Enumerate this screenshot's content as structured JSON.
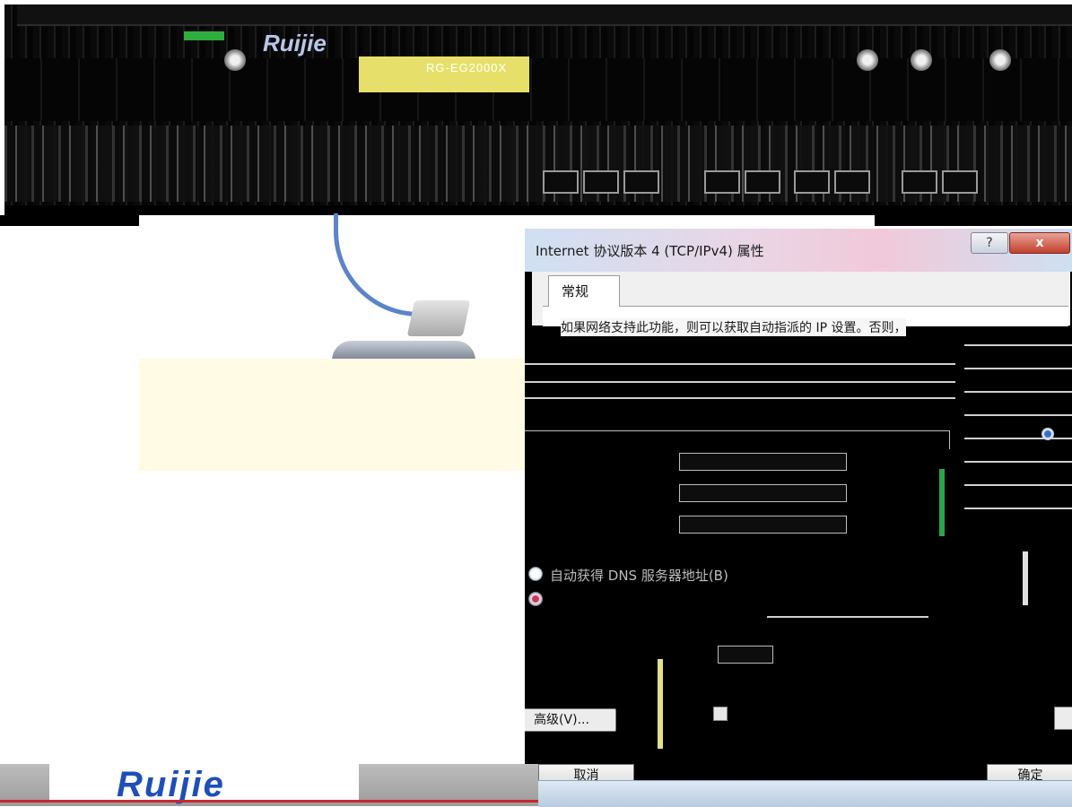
{
  "router": {
    "logo": "Ruijie",
    "model": "RG-EG2000X"
  },
  "dialog": {
    "title": "Internet 协议版本 4 (TCP/IPv4) 属性",
    "help_label": "?",
    "close_label": "x",
    "tab_general": "常规",
    "intro": "如果网络支持此功能，则可以获取自动指派的 IP 设置。否则，",
    "dns_auto_label": "自动获得 DNS 服务器地址(B)",
    "dns_auto_selected": false,
    "dns_manual_selected": true,
    "validate_checked": false,
    "advanced_label": "高级(V)...",
    "cancel_label": "取消",
    "ok_label": "确定"
  },
  "footer": {
    "logo": "Ruijie"
  },
  "icons": {
    "help": "help-icon",
    "close": "close-icon"
  },
  "colors": {
    "brand_blue": "#1e4fb8",
    "cable_blue": "#5b84c9",
    "close_red": "#c2402d",
    "dialog_body": "#000000"
  }
}
